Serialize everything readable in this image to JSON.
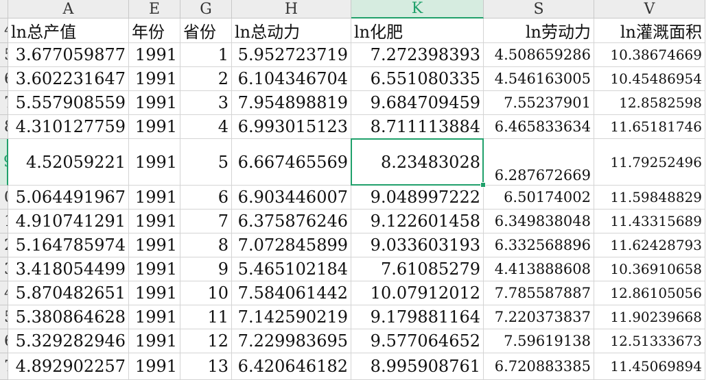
{
  "columns": [
    {
      "letter": "A",
      "title": "ln总产值"
    },
    {
      "letter": "E",
      "title": "年份"
    },
    {
      "letter": "G",
      "title": "省份"
    },
    {
      "letter": "H",
      "title": "ln总动力"
    },
    {
      "letter": "K",
      "title": "ln化肥"
    },
    {
      "letter": "S",
      "title": "ln劳动力"
    },
    {
      "letter": "V",
      "title": "ln灌溉面积"
    }
  ],
  "active_column": "K",
  "row_numbers": [
    "4",
    "5",
    "6",
    "7",
    "8",
    "9",
    "0",
    "1",
    "2",
    "3",
    "4",
    "5",
    "6",
    "7"
  ],
  "active_row_index": 5,
  "rows": [
    [
      "3.677059877",
      "1991",
      "1",
      "5.952723719",
      "7.272398393",
      "4.508659286",
      "10.38674669"
    ],
    [
      "3.602231647",
      "1991",
      "2",
      "6.104346704",
      "6.551080335",
      "4.546163005",
      "10.45486954"
    ],
    [
      "5.557908559",
      "1991",
      "3",
      "7.954898819",
      "9.684709459",
      "7.55237901",
      "12.8582598"
    ],
    [
      "4.310127759",
      "1991",
      "4",
      "6.993015123",
      "8.711113884",
      "6.465833634",
      "11.65181746"
    ],
    [
      "4.52059221",
      "1991",
      "5",
      "6.667465569",
      "8.23483028",
      "6.287672669",
      "11.79252496"
    ],
    [
      "5.064491967",
      "1991",
      "6",
      "6.903446007",
      "9.048997222",
      "6.50174002",
      "11.59848829"
    ],
    [
      "4.910741291",
      "1991",
      "7",
      "6.375876246",
      "9.122601458",
      "6.349838048",
      "11.43315689"
    ],
    [
      "5.164785974",
      "1991",
      "8",
      "7.072845899",
      "9.033603193",
      "6.332568896",
      "11.62428793"
    ],
    [
      "3.418054499",
      "1991",
      "9",
      "5.465102184",
      "7.61085279",
      "4.413888608",
      "10.36910658"
    ],
    [
      "5.870482651",
      "1991",
      "10",
      "7.584061442",
      "10.07912012",
      "7.785587887",
      "12.86105056"
    ],
    [
      "5.380864628",
      "1991",
      "11",
      "7.142590219",
      "9.179881164",
      "7.220373837",
      "11.90239668"
    ],
    [
      "5.329282946",
      "1991",
      "12",
      "7.229983695",
      "9.577064652",
      "7.59619138",
      "12.51333673"
    ],
    [
      "4.892902257",
      "1991",
      "13",
      "6.420646182",
      "8.995908761",
      "6.720883385",
      "11.45069894"
    ]
  ]
}
